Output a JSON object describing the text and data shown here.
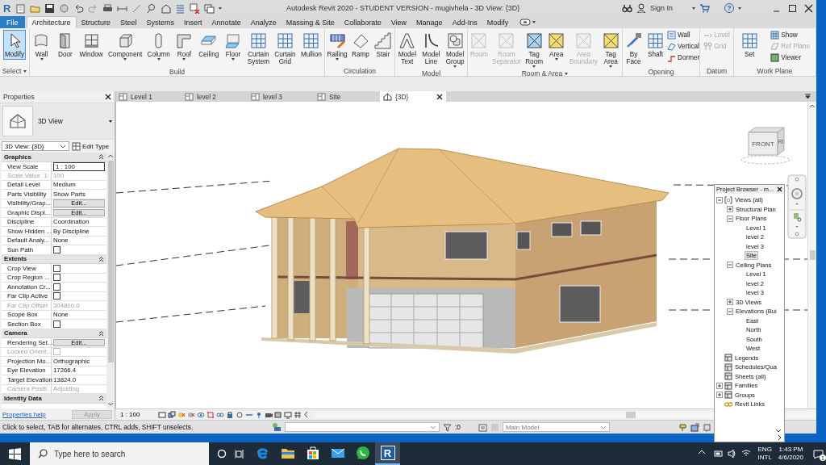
{
  "title_bar": {
    "logo": "R",
    "title": "Autodesk Revit 2020 - STUDENT VERSION - mugivhela - 3D View: {3D}",
    "sign_in": "Sign In",
    "help": "?"
  },
  "ribbon_tabs": [
    {
      "label": "File",
      "kind": "file",
      "selected": false
    },
    {
      "label": "Architecture",
      "kind": "tab",
      "selected": true
    },
    {
      "label": "Structure",
      "kind": "tab",
      "selected": false
    },
    {
      "label": "Steel",
      "kind": "tab",
      "selected": false
    },
    {
      "label": "Systems",
      "kind": "tab",
      "selected": false
    },
    {
      "label": "Insert",
      "kind": "tab",
      "selected": false
    },
    {
      "label": "Annotate",
      "kind": "tab",
      "selected": false
    },
    {
      "label": "Analyze",
      "kind": "tab",
      "selected": false
    },
    {
      "label": "Massing & Site",
      "kind": "tab",
      "selected": false
    },
    {
      "label": "Collaborate",
      "kind": "tab",
      "selected": false
    },
    {
      "label": "View",
      "kind": "tab",
      "selected": false
    },
    {
      "label": "Manage",
      "kind": "tab",
      "selected": false
    },
    {
      "label": "Add-Ins",
      "kind": "tab",
      "selected": false
    },
    {
      "label": "Modify",
      "kind": "tab",
      "selected": false
    }
  ],
  "ribbon_panels": [
    {
      "title": "Select",
      "menu": true,
      "tools": [
        {
          "label": "Modify",
          "kind": "large",
          "active": true,
          "disabled": false,
          "dropdown": false
        }
      ]
    },
    {
      "title": "Build",
      "menu": false,
      "tools": [
        {
          "label": "Wall",
          "kind": "large",
          "active": false,
          "disabled": false,
          "dropdown": true
        },
        {
          "label": "Door",
          "kind": "large",
          "active": false,
          "disabled": false,
          "dropdown": false
        },
        {
          "label": "Window",
          "kind": "large",
          "active": false,
          "disabled": false,
          "dropdown": false
        },
        {
          "label": "Component",
          "kind": "large",
          "active": false,
          "disabled": false,
          "dropdown": true
        },
        {
          "label": "Column",
          "kind": "large",
          "active": false,
          "disabled": false,
          "dropdown": true
        },
        {
          "label": "Roof",
          "kind": "large",
          "active": false,
          "disabled": false,
          "dropdown": true
        },
        {
          "label": "Ceiling",
          "kind": "large",
          "active": false,
          "disabled": false,
          "dropdown": false
        },
        {
          "label": "Floor",
          "kind": "large",
          "active": false,
          "disabled": false,
          "dropdown": true
        },
        {
          "label": "Curtain System",
          "kind": "large",
          "active": false,
          "disabled": false,
          "dropdown": false
        },
        {
          "label": "Curtain Grid",
          "kind": "large",
          "active": false,
          "disabled": false,
          "dropdown": false
        },
        {
          "label": "Mullion",
          "kind": "large",
          "active": false,
          "disabled": false,
          "dropdown": false
        }
      ]
    },
    {
      "title": "Circulation",
      "menu": false,
      "tools": [
        {
          "label": "Railing",
          "kind": "large",
          "active": false,
          "disabled": false,
          "dropdown": true
        },
        {
          "label": "Ramp",
          "kind": "large",
          "active": false,
          "disabled": false,
          "dropdown": false
        },
        {
          "label": "Stair",
          "kind": "large",
          "active": false,
          "disabled": false,
          "dropdown": false
        }
      ]
    },
    {
      "title": "Model",
      "menu": false,
      "tools": [
        {
          "label": "Model Text",
          "kind": "large",
          "active": false,
          "disabled": false,
          "dropdown": false
        },
        {
          "label": "Model Line",
          "kind": "large",
          "active": false,
          "disabled": false,
          "dropdown": false
        },
        {
          "label": "Model Group",
          "kind": "large",
          "active": false,
          "disabled": false,
          "dropdown": true
        }
      ]
    },
    {
      "title": "Room & Area",
      "menu": true,
      "tools": [
        {
          "label": "Room",
          "kind": "large",
          "active": false,
          "disabled": true,
          "dropdown": false
        },
        {
          "label": "Room Separator",
          "kind": "large",
          "active": false,
          "disabled": true,
          "dropdown": false
        },
        {
          "label": "Tag Room",
          "kind": "large",
          "active": false,
          "disabled": false,
          "dropdown": true
        },
        {
          "label": "Area",
          "kind": "large",
          "active": false,
          "disabled": false,
          "dropdown": true
        },
        {
          "label": "Area Boundary",
          "kind": "large",
          "active": false,
          "disabled": true,
          "dropdown": false
        },
        {
          "label": "Tag Area",
          "kind": "large",
          "active": false,
          "disabled": false,
          "dropdown": true
        }
      ]
    },
    {
      "title": "Opening",
      "menu": false,
      "tools": [
        {
          "label": "By Face",
          "kind": "large",
          "active": false,
          "disabled": false,
          "dropdown": false
        },
        {
          "label": "Shaft",
          "kind": "large",
          "active": false,
          "disabled": false,
          "dropdown": false
        },
        {
          "label": "Wall",
          "kind": "small",
          "active": false,
          "disabled": false,
          "dropdown": false
        },
        {
          "label": "Vertical",
          "kind": "small",
          "active": false,
          "disabled": false,
          "dropdown": false
        },
        {
          "label": "Dormer",
          "kind": "small",
          "active": false,
          "disabled": false,
          "dropdown": false
        }
      ]
    },
    {
      "title": "Datum",
      "menu": false,
      "tools": [
        {
          "label": "Level",
          "kind": "small",
          "active": false,
          "disabled": true,
          "dropdown": false
        },
        {
          "label": "Grid",
          "kind": "small",
          "active": false,
          "disabled": true,
          "dropdown": false
        }
      ]
    },
    {
      "title": "Work Plane",
      "menu": false,
      "tools": [
        {
          "label": "Set",
          "kind": "large",
          "active": false,
          "disabled": false,
          "dropdown": false
        },
        {
          "label": "Show",
          "kind": "small",
          "active": false,
          "disabled": false,
          "dropdown": false
        },
        {
          "label": "Ref Plane",
          "kind": "small",
          "active": false,
          "disabled": true,
          "dropdown": false
        },
        {
          "label": "Viewer",
          "kind": "small",
          "active": false,
          "disabled": false,
          "dropdown": false
        }
      ]
    }
  ],
  "properties": {
    "title": "Properties",
    "type_name": "3D View",
    "view_selector": "3D View: {3D}",
    "edit_type": "Edit Type",
    "groups": [
      {
        "name": "Graphics",
        "rows": [
          {
            "label": "View Scale",
            "kind": "input",
            "value": "1 : 100",
            "disabled": false
          },
          {
            "label": "Scale Value",
            "prefix": "1:",
            "kind": "text",
            "value": "100",
            "disabled": true
          },
          {
            "label": "Detail Level",
            "kind": "text",
            "value": "Medium",
            "disabled": false
          },
          {
            "label": "Parts Visibility",
            "kind": "text",
            "value": "Show Parts",
            "disabled": false
          },
          {
            "label": "Visibility/Grap...",
            "kind": "button",
            "value": "Edit...",
            "disabled": false
          },
          {
            "label": "Graphic Displ...",
            "kind": "button",
            "value": "Edit...",
            "disabled": false
          },
          {
            "label": "Discipline",
            "kind": "text",
            "value": "Coordination",
            "disabled": false
          },
          {
            "label": "Show Hidden ...",
            "kind": "text",
            "value": "By Discipline",
            "disabled": false
          },
          {
            "label": "Default Analy...",
            "kind": "text",
            "value": "None",
            "disabled": false
          },
          {
            "label": "Sun Path",
            "kind": "checkbox",
            "checked": false,
            "disabled": false
          }
        ]
      },
      {
        "name": "Extents",
        "rows": [
          {
            "label": "Crop View",
            "kind": "checkbox",
            "checked": false,
            "disabled": false
          },
          {
            "label": "Crop Region ...",
            "kind": "checkbox",
            "checked": false,
            "disabled": false
          },
          {
            "label": "Annotation Cr...",
            "kind": "checkbox",
            "checked": false,
            "disabled": false
          },
          {
            "label": "Far Clip Active",
            "kind": "checkbox",
            "checked": false,
            "disabled": false
          },
          {
            "label": "Far Clip Offset",
            "kind": "text",
            "value": "304800.0",
            "disabled": true
          },
          {
            "label": "Scope Box",
            "kind": "text",
            "value": "None",
            "disabled": false
          },
          {
            "label": "Section Box",
            "kind": "checkbox",
            "checked": false,
            "disabled": false
          }
        ]
      },
      {
        "name": "Camera",
        "rows": [
          {
            "label": "Rendering Set...",
            "kind": "button",
            "value": "Edit...",
            "disabled": false
          },
          {
            "label": "Locked Orient...",
            "kind": "checkbox",
            "checked": false,
            "disabled": true
          },
          {
            "label": "Projection Mo...",
            "kind": "text",
            "value": "Orthographic",
            "disabled": false
          },
          {
            "label": "Eye Elevation",
            "kind": "text",
            "value": "17266.4",
            "disabled": false
          },
          {
            "label": "Target Elevation",
            "kind": "text",
            "value": "13824.0",
            "disabled": false
          },
          {
            "label": "Camera Positi...",
            "kind": "text",
            "value": "Adjusting",
            "disabled": true
          }
        ]
      },
      {
        "name": "Identity Data"
      }
    ],
    "help_link": "Properties help",
    "apply": {
      "label": "Apply",
      "disabled": true
    }
  },
  "view_tabs": [
    {
      "label": "Level 1",
      "kind": "plan",
      "selected": false
    },
    {
      "label": "level 2",
      "kind": "plan",
      "selected": false
    },
    {
      "label": "level 3",
      "kind": "plan",
      "selected": false
    },
    {
      "label": "Site",
      "kind": "plan",
      "selected": false
    },
    {
      "label": "{3D}",
      "kind": "model",
      "selected": true
    }
  ],
  "viewport": {
    "view_cube": {
      "front": "FRONT",
      "right": "RI"
    }
  },
  "view_control_bar": {
    "scale": "1 : 100"
  },
  "status_bar": {
    "message": "Click to select, TAB for alternates, CTRL adds, SHIFT unselects.",
    "filter_count": ":0",
    "model": "Main Model"
  },
  "project_browser": {
    "title": "Project Browser - m...",
    "tree": [
      {
        "label": "Views (all)",
        "expanded": true,
        "selected": false,
        "children": [
          {
            "label": "Structural Plan",
            "expanded": false,
            "selected": false
          },
          {
            "label": "Floor Plans",
            "expanded": true,
            "selected": false,
            "children": [
              {
                "label": "Level 1",
                "selected": false
              },
              {
                "label": "level 2",
                "selected": false
              },
              {
                "label": "level 3",
                "selected": false
              },
              {
                "label": "Site",
                "selected": true
              }
            ]
          },
          {
            "label": "Ceiling Plans",
            "expanded": true,
            "selected": false,
            "children": [
              {
                "label": "Level 1",
                "selected": false
              },
              {
                "label": "level 2",
                "selected": false
              },
              {
                "label": "level 3",
                "selected": false
              }
            ]
          },
          {
            "label": "3D Views",
            "expanded": false,
            "selected": false
          },
          {
            "label": "Elevations (Bui",
            "expanded": true,
            "selected": false,
            "children": [
              {
                "label": "East",
                "selected": false
              },
              {
                "label": "North",
                "selected": false
              },
              {
                "label": "South",
                "selected": false
              },
              {
                "label": "West",
                "selected": false
              }
            ]
          }
        ]
      },
      {
        "label": "Legends",
        "selected": false
      },
      {
        "label": "Schedules/Qua",
        "selected": false
      },
      {
        "label": "Sheets (all)",
        "selected": false
      },
      {
        "label": "Families",
        "expanded": false,
        "selected": false
      },
      {
        "label": "Groups",
        "expanded": false,
        "selected": false
      },
      {
        "label": "Revit Links",
        "selected": false
      }
    ]
  },
  "taskbar": {
    "search_placeholder": "Type here to search",
    "apps": [
      {
        "running": false,
        "selected": false
      },
      {
        "running": false,
        "selected": false
      },
      {
        "running": false,
        "selected": false
      },
      {
        "running": false,
        "selected": false
      },
      {
        "running": false,
        "selected": false
      },
      {
        "label": "R",
        "running": true,
        "selected": true
      }
    ],
    "language": "ENG",
    "layout": "INTL",
    "time": "1:43 PM",
    "date": "4/6/2020",
    "notifications": "1"
  }
}
